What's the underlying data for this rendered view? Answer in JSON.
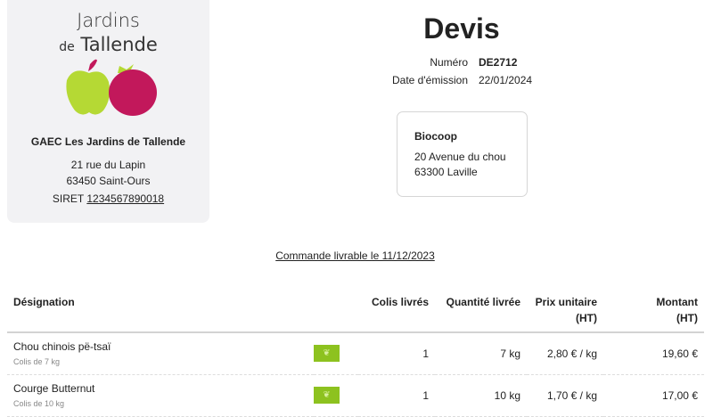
{
  "logo": {
    "line1": "Jardins",
    "line2_small": "de",
    "line2": "Tallende"
  },
  "company": {
    "name": "GAEC Les Jardins de Tallende",
    "street": "21 rue du Lapin",
    "city": "63450 Saint-Ours",
    "siret_label": "SIRET",
    "siret": "1234567890018"
  },
  "doc": {
    "title": "Devis",
    "number_label": "Numéro",
    "number": "DE2712",
    "date_label": "Date d'émission",
    "date": "22/01/2024"
  },
  "client": {
    "name": "Biocoop",
    "street": "20 Avenue du chou",
    "city": "63300 Laville"
  },
  "delivery": "Commande livrable le 11/12/2023",
  "table": {
    "headers": {
      "designation": "Désignation",
      "colis": "Colis livrés",
      "quantite": "Quantité livrée",
      "prix1": "Prix unitaire",
      "prix2": "(HT)",
      "montant1": "Montant",
      "montant2": "(HT)"
    },
    "rows": [
      {
        "name": "Chou chinois pë-tsaï",
        "sub": "Colis de 7 kg",
        "colis": "1",
        "quantite": "7 kg",
        "prix": "2,80 € / kg",
        "montant": "19,60 €"
      },
      {
        "name": "Courge Butternut",
        "sub": "Colis de 10 kg",
        "colis": "1",
        "quantite": "10 kg",
        "prix": "1,70 € / kg",
        "montant": "17,00 €"
      }
    ]
  }
}
